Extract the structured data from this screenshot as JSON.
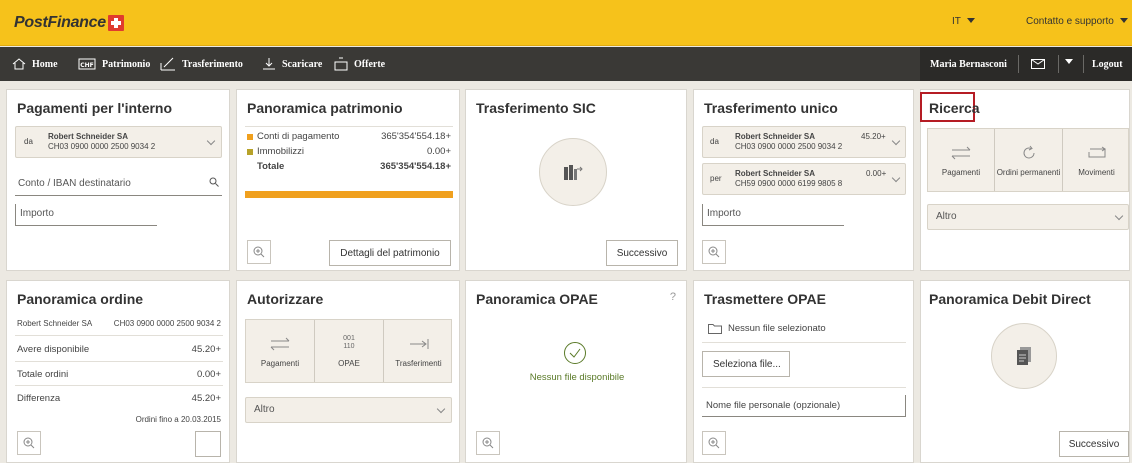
{
  "header": {
    "logo_text": "PostFinance",
    "language": "IT",
    "support": "Contatto e supporto"
  },
  "nav": {
    "home": "Home",
    "assets": "Patrimonio",
    "transfer": "Trasferimento",
    "download": "Scaricare",
    "offers": "Offerte",
    "user": "Maria Bernasconi",
    "logout": "Logout"
  },
  "domestic": {
    "title": "Pagamenti per l'interno",
    "from_label": "da",
    "from_name": "Robert Schneider SA",
    "from_iban": "CH03 0900 0000 2500 9034 2",
    "account_placeholder": "Conto / IBAN destinatario",
    "amount_placeholder": "Importo"
  },
  "assets": {
    "title": "Panoramica patrimonio",
    "rows": [
      {
        "label": "Conti di pagamento",
        "value": "365'354'554.18+"
      },
      {
        "label": "Immobilizzi",
        "value": "0.00+"
      },
      {
        "label": "Totale",
        "value": "365'354'554.18+"
      }
    ],
    "details_button": "Dettagli del patrimonio"
  },
  "sic": {
    "title": "Trasferimento SIC",
    "next_button": "Successivo"
  },
  "single": {
    "title": "Trasferimento unico",
    "from_label": "da",
    "from_name": "Robert Schneider SA",
    "from_iban": "CH03 0900 0000 2500 9034 2",
    "from_amount": "45.20+",
    "to_label": "per",
    "to_name": "Robert Schneider SA",
    "to_iban": "CH59 0900 0000 6199 9805 8",
    "to_amount": "0.00+",
    "amount_placeholder": "Importo"
  },
  "search": {
    "title": "Ricerca",
    "tiles": [
      "Pagamenti",
      "Ordini permanenti",
      "Movimenti"
    ],
    "other": "Altro",
    "highlight_color": "#b51c24"
  },
  "orders": {
    "title": "Panoramica ordine",
    "account_name": "Robert Schneider SA",
    "account_iban": "CH03 0900 0000 2500 9034 2",
    "rows": [
      {
        "label": "Avere disponibile",
        "value": "45.20+"
      },
      {
        "label": "Totale ordini",
        "value": "0.00+"
      },
      {
        "label": "Differenza",
        "value": "45.20+"
      }
    ],
    "footnote": "Ordini fino a 20.03.2015"
  },
  "authorize": {
    "title": "Autorizzare",
    "tiles": [
      "Pagamenti",
      "OPAE",
      "Trasferimenti"
    ],
    "opae_code": [
      "001",
      "110"
    ],
    "other": "Altro"
  },
  "opae_overview": {
    "title": "Panoramica OPAE",
    "help": "?",
    "empty_text": "Nessun file disponibile"
  },
  "send_opae": {
    "title": "Trasmettere OPAE",
    "no_file": "Nessun file selezionato",
    "select_button": "Seleziona file...",
    "filename_placeholder": "Nome file personale (opzionale)"
  },
  "debit": {
    "title": "Panoramica Debit Direct",
    "next_button": "Successivo"
  },
  "colors": {
    "header": "#f6c21b",
    "nav": "#3a3936",
    "accent_orange": "#f0a01e",
    "success_green": "#5a7a28"
  }
}
